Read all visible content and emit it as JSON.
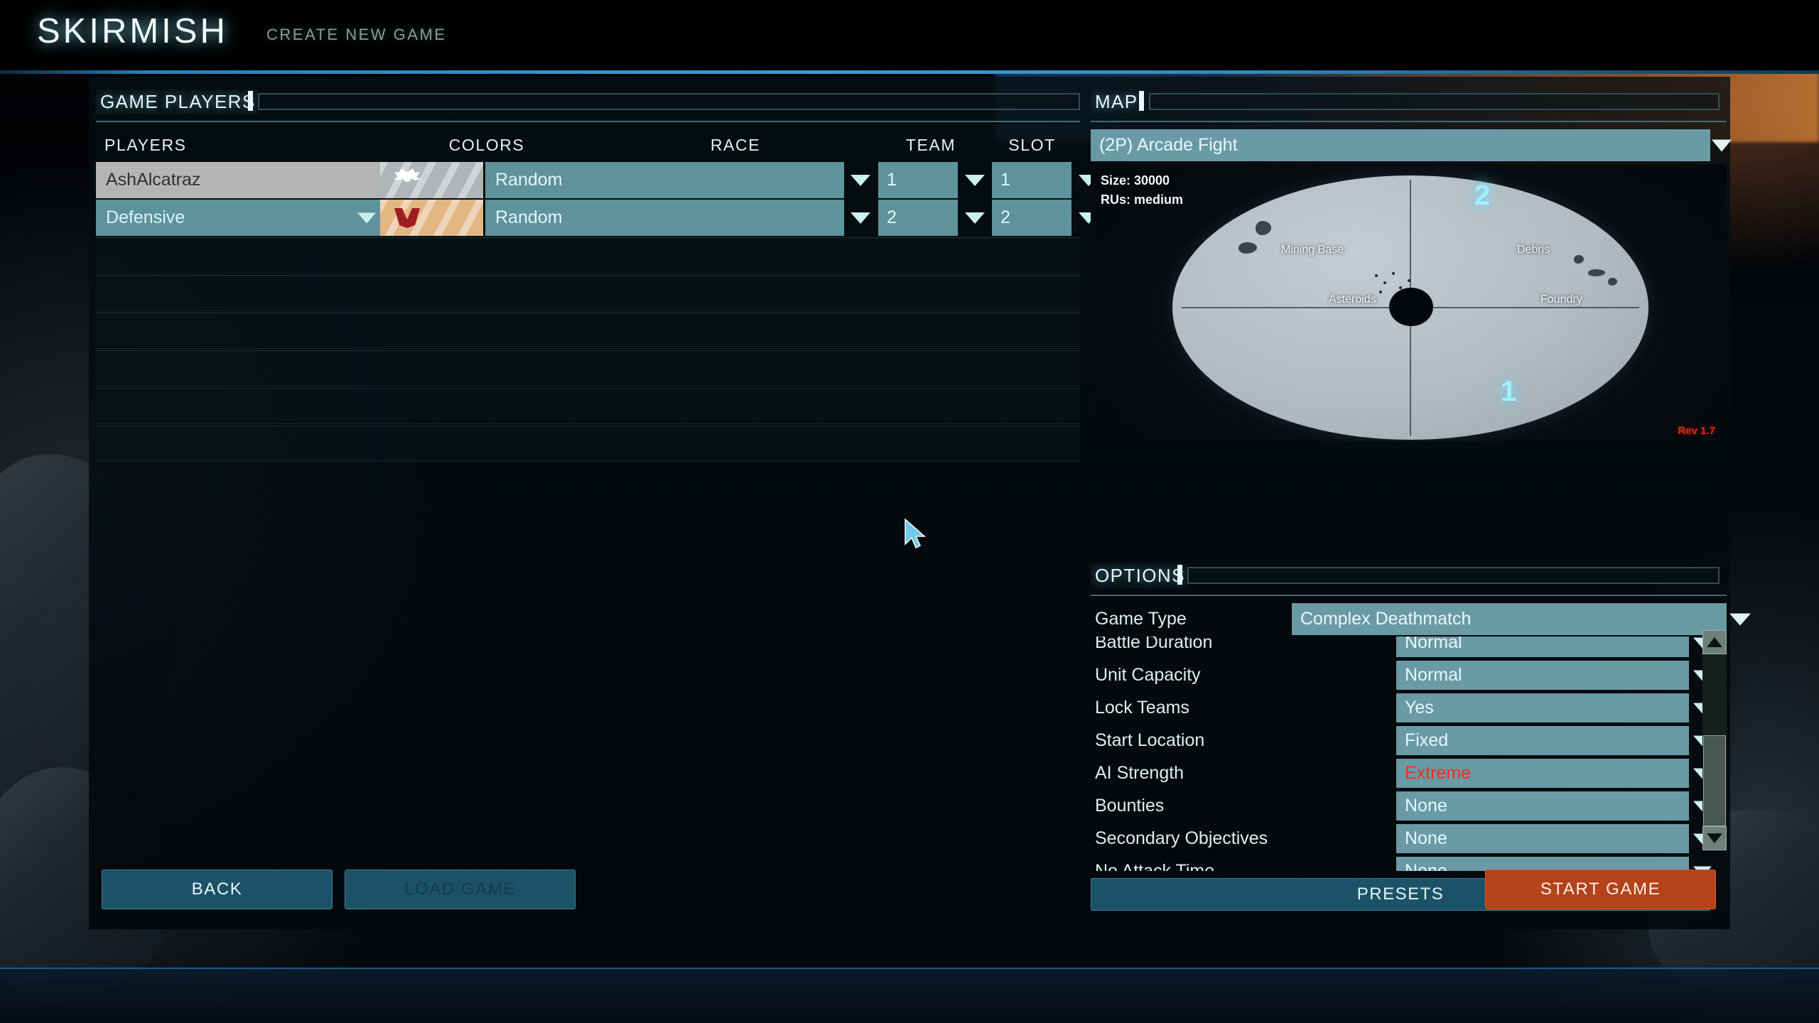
{
  "header": {
    "title": "SKIRMISH",
    "subtitle": "CREATE NEW GAME"
  },
  "players_panel": {
    "section_label": "GAME PLAYERS",
    "columns": {
      "players": "PLAYERS",
      "colors": "COLORS",
      "race": "RACE",
      "team": "TEAM",
      "slot": "SLOT"
    },
    "rows": [
      {
        "name": "AshAlcatraz",
        "is_human": true,
        "has_name_caret": false,
        "color_hex": "#b0b5b8",
        "insignia": "eagle-insignia",
        "insignia_hex": "#ffffff",
        "race": "Random",
        "team": "1",
        "slot": "1"
      },
      {
        "name": "Defensive",
        "is_human": false,
        "has_name_caret": true,
        "color_hex": "#e3b684",
        "insignia": "chevron-insignia",
        "insignia_hex": "#9e1f22",
        "race": "Random",
        "team": "2",
        "slot": "2"
      }
    ],
    "empty_slot_count": 6
  },
  "map_panel": {
    "section_label": "MAP",
    "selected_map": "(2P) Arcade Fight",
    "size_text": "Size: 30000",
    "rus_text": "RUs: medium",
    "revision": "Rev 1.7",
    "feature_labels": [
      "Mining Base",
      "Debris",
      "Asteroids",
      "Foundry"
    ],
    "spawn_markers": [
      "2",
      "1"
    ]
  },
  "options_panel": {
    "section_label": "OPTIONS",
    "game_type": {
      "label": "Game Type",
      "value": "Complex Deathmatch"
    },
    "rows": [
      {
        "label": "Battle Duration",
        "value": "Normal",
        "highlight": false
      },
      {
        "label": "Unit Capacity",
        "value": "Normal",
        "highlight": false
      },
      {
        "label": "Lock Teams",
        "value": "Yes",
        "highlight": false
      },
      {
        "label": "Start Location",
        "value": "Fixed",
        "highlight": false
      },
      {
        "label": "AI Strength",
        "value": "Extreme",
        "highlight": true
      },
      {
        "label": "Bounties",
        "value": "None",
        "highlight": false
      },
      {
        "label": "Secondary Objectives",
        "value": "None",
        "highlight": false
      },
      {
        "label": "No Attack Time",
        "value": "None",
        "highlight": false
      }
    ],
    "presets_label": "PRESETS"
  },
  "footer": {
    "back_label": "BACK",
    "load_label": "LOAD GAME",
    "start_label": "START GAME"
  },
  "colors": {
    "accent_teal": "#6a9aa5",
    "panel_blue": "#1b5268",
    "start_orange": "#b4421a",
    "alert_red": "#ff2a22",
    "revision_red": "#e02b16"
  }
}
